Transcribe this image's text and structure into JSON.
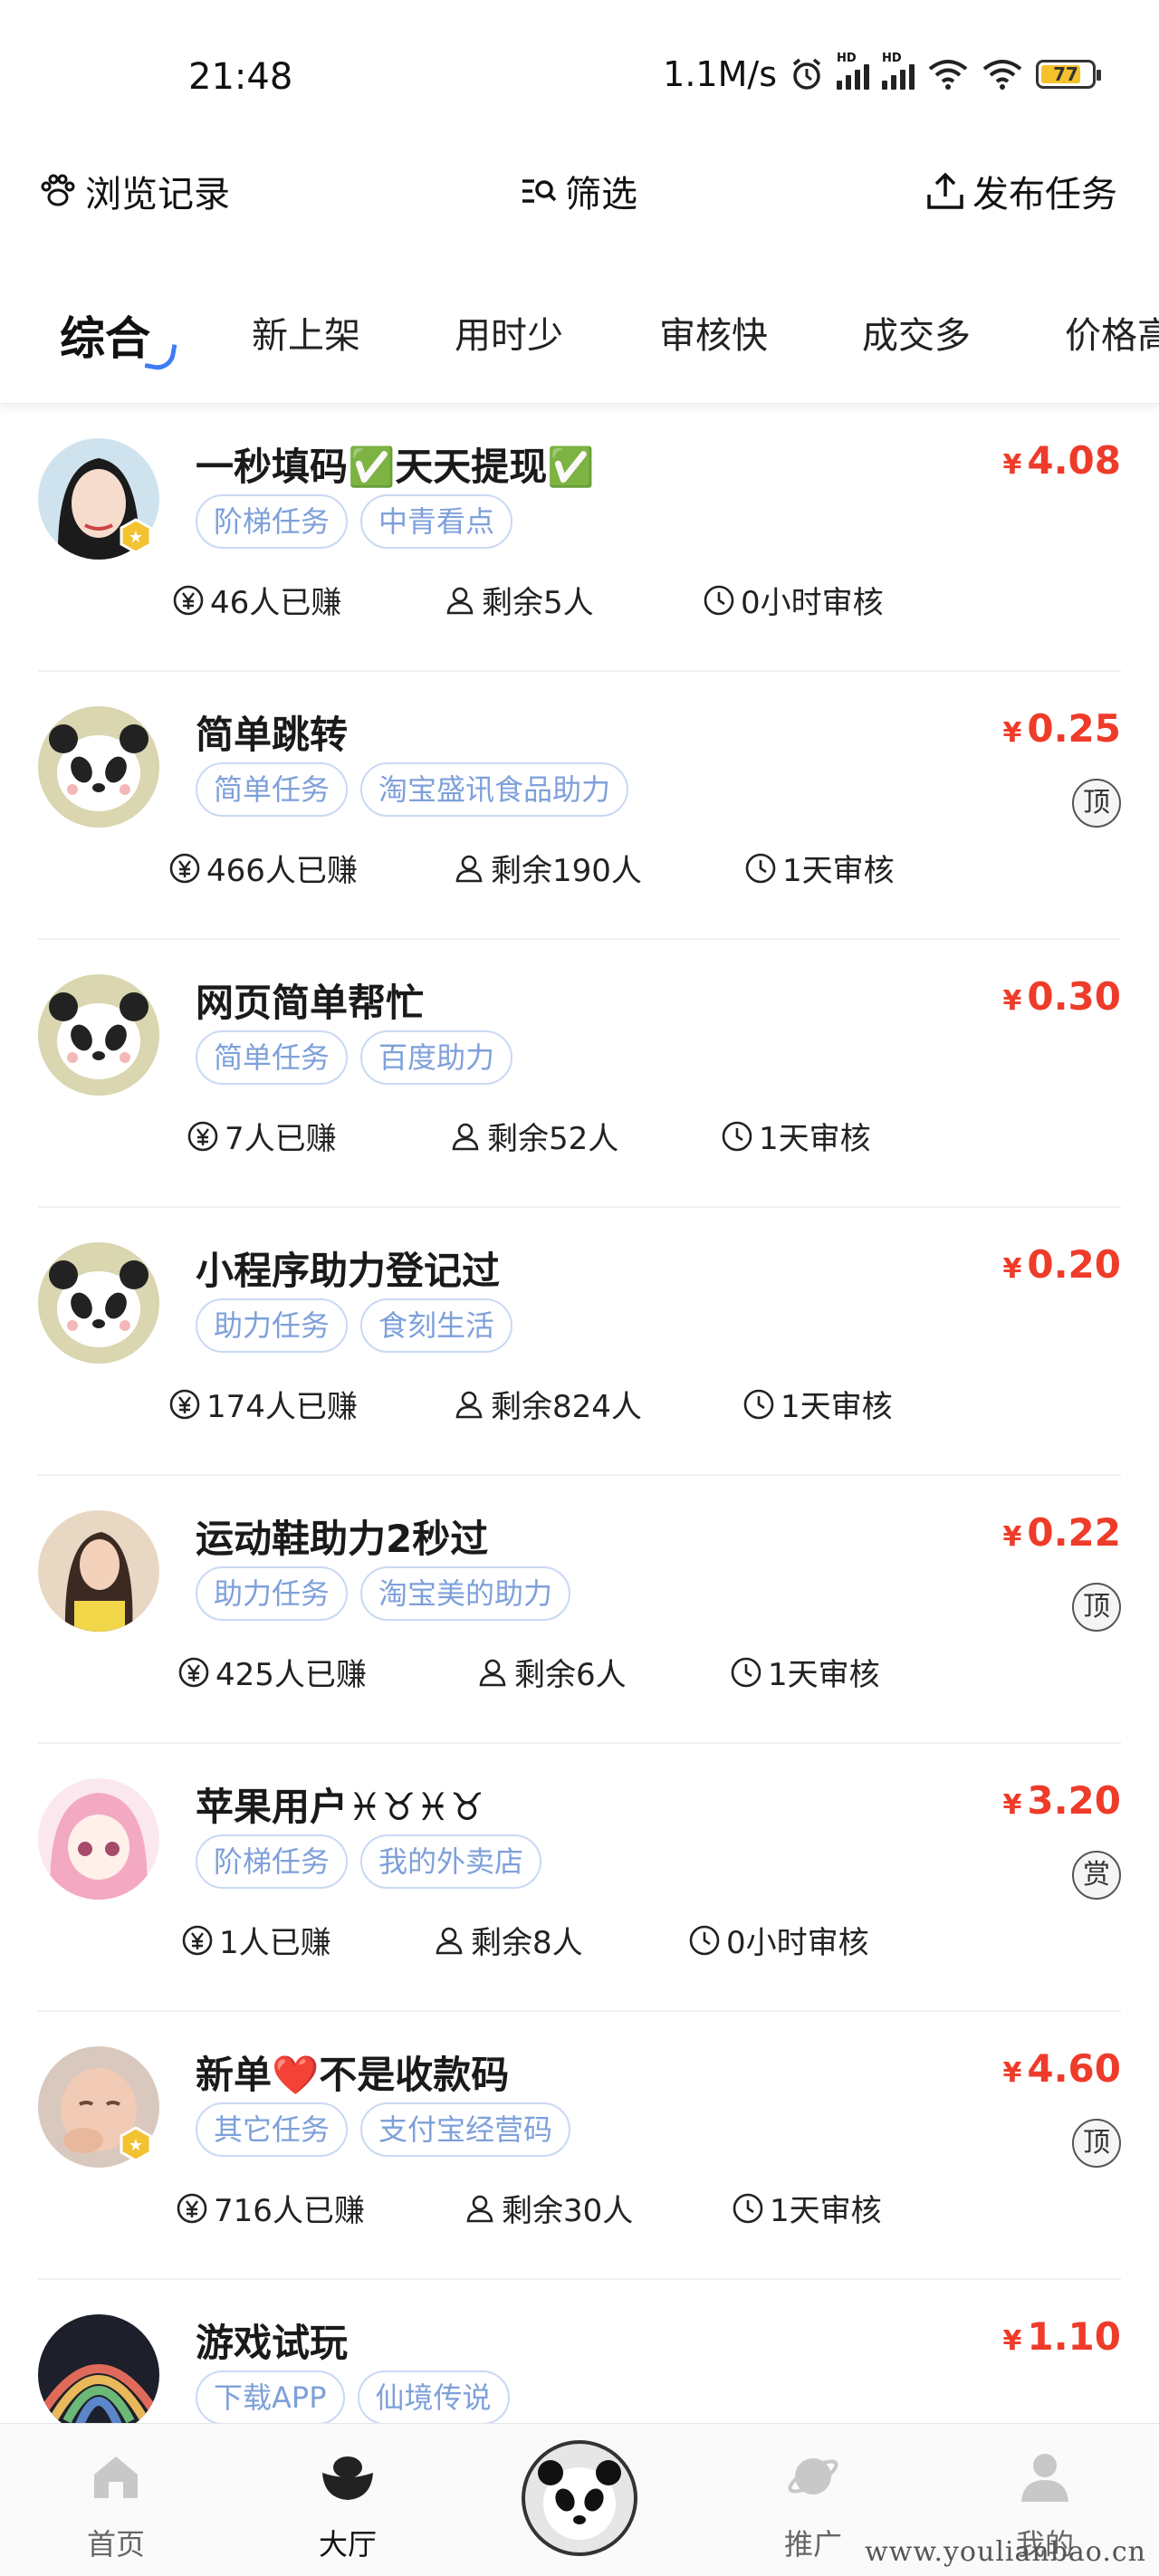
{
  "status_bar": {
    "time": "21:48",
    "speed": "1.1M/s",
    "battery": "77"
  },
  "header": {
    "history": "浏览记录",
    "filter": "筛选",
    "publish": "发布任务"
  },
  "tabs": [
    "综合",
    "新上架",
    "用时少",
    "审核快",
    "成交多",
    "价格高"
  ],
  "tasks": [
    {
      "title": "一秒填码✅天天提现✅",
      "price": "4.08",
      "tags": [
        "阶梯任务",
        "中青看点"
      ],
      "earned": "46人已赚",
      "remaining": "剩余5人",
      "review": "0小时审核",
      "mark": "",
      "avatar": "girl-photo"
    },
    {
      "title": "简单跳转",
      "price": "0.25",
      "tags": [
        "简单任务",
        "淘宝盛讯食品助力"
      ],
      "earned": "466人已赚",
      "remaining": "剩余190人",
      "review": "1天审核",
      "mark": "顶",
      "avatar": "panda"
    },
    {
      "title": "网页简单帮忙",
      "price": "0.30",
      "tags": [
        "简单任务",
        "百度助力"
      ],
      "earned": "7人已赚",
      "remaining": "剩余52人",
      "review": "1天审核",
      "mark": "",
      "avatar": "panda"
    },
    {
      "title": "小程序助力登记过",
      "price": "0.20",
      "tags": [
        "助力任务",
        "食刻生活"
      ],
      "earned": "174人已赚",
      "remaining": "剩余824人",
      "review": "1天审核",
      "mark": "",
      "avatar": "panda"
    },
    {
      "title": "运动鞋助力2秒过",
      "price": "0.22",
      "tags": [
        "助力任务",
        "淘宝美的助力"
      ],
      "earned": "425人已赚",
      "remaining": "剩余6人",
      "review": "1天审核",
      "mark": "顶",
      "avatar": "girl-yellow"
    },
    {
      "title": "苹果用户♓♉♓♉",
      "price": "3.20",
      "tags": [
        "阶梯任务",
        "我的外卖店"
      ],
      "earned": "1人已赚",
      "remaining": "剩余8人",
      "review": "0小时审核",
      "mark": "赏",
      "avatar": "anime-girl"
    },
    {
      "title": "新单❤️不是收款码",
      "price": "4.60",
      "tags": [
        "其它任务",
        "支付宝经营码"
      ],
      "earned": "716人已赚",
      "remaining": "剩余30人",
      "review": "1天审核",
      "mark": "顶",
      "avatar": "baby-photo"
    },
    {
      "title": "游戏试玩",
      "price": "1.10",
      "tags": [
        "下载APP",
        "仙境传说"
      ],
      "earned": "",
      "remaining": "",
      "review": "",
      "mark": "",
      "avatar": "rainbow"
    }
  ],
  "nav": {
    "home": "首页",
    "hall": "大厅",
    "promote": "推广",
    "mine": "我的"
  },
  "watermark": "www.youlianbao.cn",
  "colors": {
    "price": "#ee3b2a",
    "tag_text": "#7ea0da",
    "tag_border": "#c9d8f4"
  }
}
